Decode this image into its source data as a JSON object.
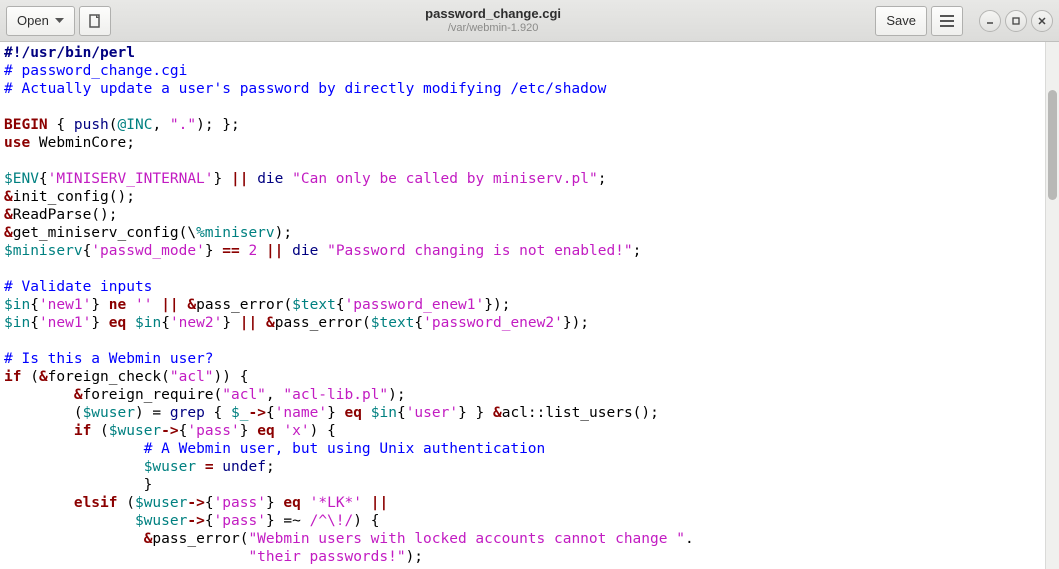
{
  "titlebar": {
    "open": "Open",
    "save": "Save",
    "filename": "password_change.cgi",
    "path": "/var/webmin-1.920"
  },
  "code": {
    "l1_shebang": "#!/usr/bin/perl",
    "l2": "# password_change.cgi",
    "l3": "# Actually update a user's password by directly modifying /etc/shadow",
    "l5_begin": "BEGIN",
    "l5_push": "push",
    "l5_inc": "@INC",
    "l5_dot": "\".\"",
    "l6_use": "use",
    "l6_mod": " WebminCore;",
    "l8_env": "$ENV",
    "l8_k": "'MINISERV_INTERNAL'",
    "l8_die": "die",
    "l8_msg": "\"Can only be called by miniserv.pl\"",
    "l9": "init_config();",
    "l10": "ReadParse();",
    "l11a": "get_miniserv_config(",
    "l11b": "%miniserv",
    "l11c": ");",
    "l12_var": "$miniserv",
    "l12_k": "'passwd_mode'",
    "l12_num": "2",
    "l12_die": "die",
    "l12_msg": "\"Password changing is not enabled!\"",
    "l14": "# Validate inputs",
    "l15_in": "$in",
    "l15_k": "'new1'",
    "l15_ne": "ne",
    "l15_empt": "''",
    "l15_pe": "pass_error(",
    "l15_txt": "$text",
    "l15_tk": "'password_enew1'",
    "l16_k2": "'new2'",
    "l16_eq": "eq",
    "l16_tk": "'password_enew2'",
    "l18": "# Is this a Webmin user?",
    "l19_if": "if",
    "l19_fc": "foreign_check(",
    "l19_acl": "\"acl\"",
    "l20_fr": "foreign_require(",
    "l20_a1": "\"acl\"",
    "l20_a2": "\"acl-lib.pl\"",
    "l21_wu": "$wuser",
    "l21_grep": "grep",
    "l21_dn": "$_",
    "l21_nm": "'name'",
    "l21_eq": "eq",
    "l21_ink": "'user'",
    "l21_lu": "acl::list_users();",
    "l22_if": "if",
    "l22_pass": "'pass'",
    "l22_eq": "eq",
    "l22_x": "'x'",
    "l23": "# A Webmin user, but using Unix authentication",
    "l24_undef": "undef",
    "l26_elsif": "elsif",
    "l26_lk": "'*LK*'",
    "l27_re": "/^\\!/",
    "l28_msg1": "\"Webmin users with locked accounts cannot change \"",
    "l29_msg2": "\"their passwords!\""
  }
}
